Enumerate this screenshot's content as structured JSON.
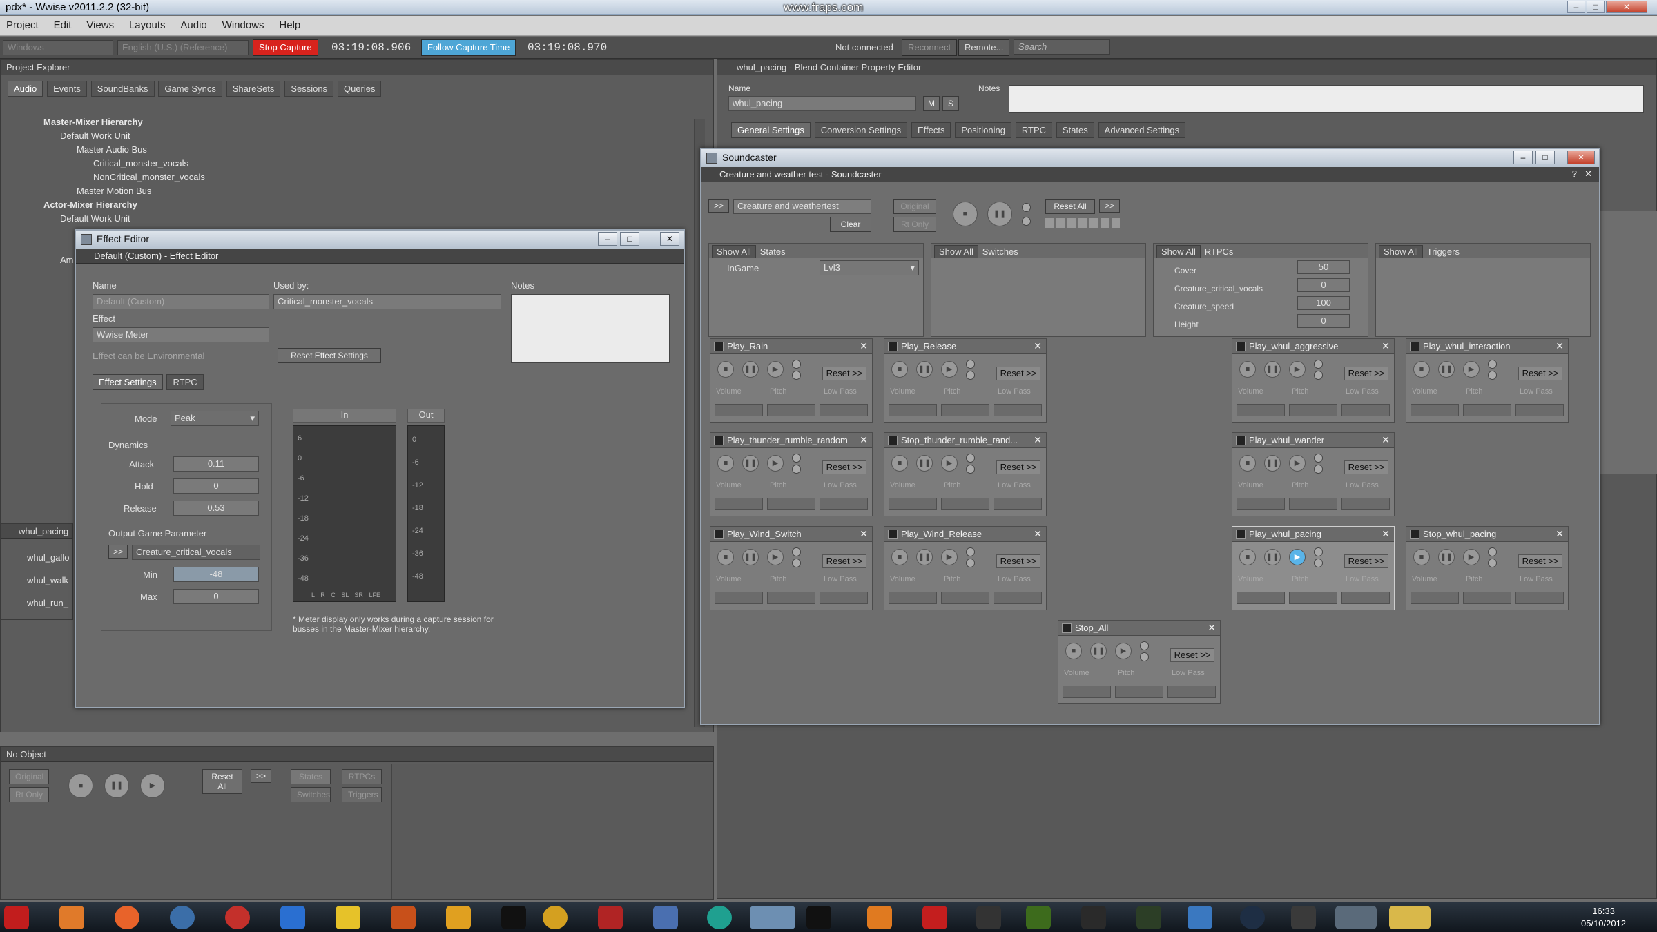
{
  "app": {
    "title": "pdx* - Wwise v2011.2.2 (32-bit)",
    "watermark": "www.fraps.com"
  },
  "menu": [
    "Project",
    "Edit",
    "Views",
    "Layouts",
    "Audio",
    "Windows",
    "Help"
  ],
  "toolbar": {
    "platform": "Windows",
    "language": "English (U.S.) (Reference)",
    "stop_capture": "Stop Capture",
    "time1": "03:19:08.906",
    "follow": "Follow Capture Time",
    "time2": "03:19:08.970",
    "status": "Not connected",
    "reconnect": "Reconnect",
    "remote": "Remote...",
    "search": "Search"
  },
  "project_explorer": {
    "title": "Project Explorer",
    "tabs": [
      "Audio",
      "Events",
      "SoundBanks",
      "Game Syncs",
      "ShareSets",
      "Sessions",
      "Queries"
    ],
    "tree": [
      "Master-Mixer Hierarchy",
      "Default Work Unit",
      "Master Audio Bus",
      "Critical_monster_vocals",
      "NonCritical_monster_vocals",
      "Master Motion Bus",
      "Actor-Mixer Hierarchy",
      "Default Work Unit",
      "Am"
    ]
  },
  "side_list": {
    "title": "whul_pacing",
    "items": [
      "whul_gallo",
      "whul_walk",
      "whul_run_"
    ]
  },
  "effect_editor": {
    "title": "Effect Editor",
    "subtitle": "Default (Custom) - Effect Editor",
    "name_label": "Name",
    "name_value": "Default (Custom)",
    "used_by_label": "Used by:",
    "used_by_value": "Critical_monster_vocals",
    "notes_label": "Notes",
    "effect_label": "Effect",
    "effect_value": "Wwise Meter",
    "env_checkbox": "Effect can be Environmental",
    "reset_btn": "Reset Effect Settings",
    "tabs": [
      "Effect Settings",
      "RTPC"
    ],
    "mode_label": "Mode",
    "mode_value": "Peak",
    "dynamics": "Dynamics",
    "attack_label": "Attack",
    "attack_value": "0.11",
    "hold_label": "Hold",
    "hold_value": "0",
    "release_label": "Release",
    "release_value": "0.53",
    "ogp_label": "Output Game Parameter",
    "ogp_btn": ">>",
    "ogp_value": "Creature_critical_vocals",
    "min_label": "Min",
    "min_value": "-48",
    "max_label": "Max",
    "max_value": "0",
    "in_label": "In",
    "out_label": "Out",
    "in_ticks": [
      "6",
      "0",
      "-6",
      "-12",
      "-18",
      "-24",
      "-36",
      "-48"
    ],
    "out_ticks": [
      "0",
      "-6",
      "-12",
      "-18",
      "-24",
      "-36",
      "-48"
    ],
    "channels": [
      "L",
      "R",
      "C",
      "SL",
      "SR",
      "LFE"
    ],
    "note": "* Meter display only works during a capture session for busses in the Master-Mixer hierarchy."
  },
  "property_editor": {
    "title": "whul_pacing - Blend Container Property Editor",
    "name_label": "Name",
    "name_value": "whul_pacing",
    "m": "M",
    "s": "S",
    "notes_label": "Notes",
    "tabs": [
      "General Settings",
      "Conversion Settings",
      "Effects",
      "Positioning",
      "RTPC",
      "States",
      "Advanced Settings"
    ]
  },
  "soundcaster": {
    "title": "Soundcaster",
    "subtitle": "Creature and weather test - Soundcaster",
    "session_name": "Creature and weathertest",
    "clear": "Clear",
    "original": "Original",
    "rt_only": "Rt Only",
    "reset_all": "Reset All",
    "more": ">>",
    "states": {
      "show_all": "Show All",
      "label": "States",
      "item": "InGame",
      "value": "Lvl3"
    },
    "switches": {
      "show_all": "Show All",
      "label": "Switches"
    },
    "rtpcs": {
      "show_all": "Show All",
      "label": "RTPCs",
      "items": [
        {
          "name": "Cover",
          "value": "50"
        },
        {
          "name": "Creature_critical_vocals",
          "value": "0"
        },
        {
          "name": "Creature_speed",
          "value": "100"
        },
        {
          "name": "Height",
          "value": "0"
        }
      ]
    },
    "triggers": {
      "show_all": "Show All",
      "label": "Triggers"
    },
    "cards_labels": {
      "reset": "Reset >>",
      "volume": "Volume",
      "pitch": "Pitch",
      "lowpass": "Low Pass"
    },
    "cards": [
      "Play_Rain",
      "Play_Release",
      "Play_whul_aggressive",
      "Play_whul_interaction",
      "Play_thunder_rumble_random",
      "Stop_thunder_rumble_rand...",
      "Play_whul_wander",
      "Play_Wind_Switch",
      "Play_Wind_Release",
      "Play_whul_pacing",
      "Stop_whul_pacing",
      "Stop_All"
    ]
  },
  "bottom": {
    "title": "No Object",
    "original": "Original",
    "rt_only": "Rt Only",
    "reset_all": "Reset All",
    "more": ">>",
    "states": "States",
    "rtpcs": "RTPCs",
    "switches": "Switches",
    "triggers": "Triggers"
  },
  "taskbar": {
    "time": "16:33",
    "date": "05/10/2012"
  }
}
